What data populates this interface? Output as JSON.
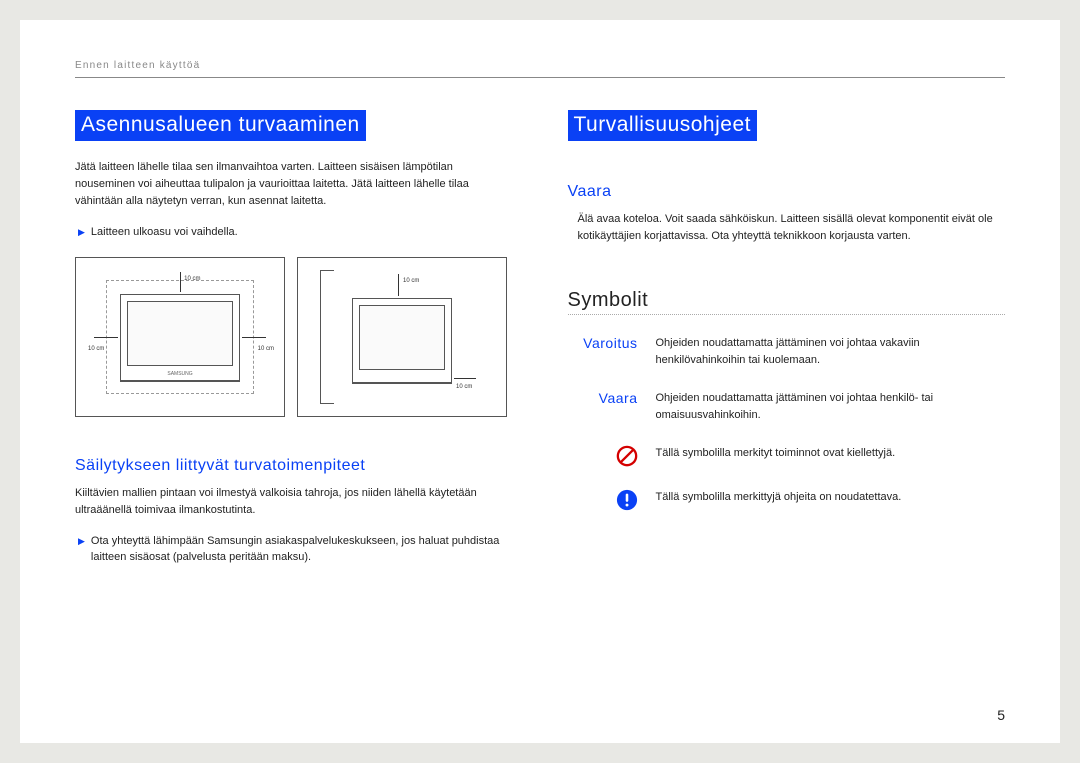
{
  "header": "Ennen laitteen käyttöä",
  "page_number": "5",
  "left": {
    "heading": "Asennusalueen turvaaminen",
    "body": "Jätä laitteen lähelle tilaa sen ilmanvaihtoa varten. Laitteen sisäisen lämpötilan nouseminen voi aiheuttaa tulipalon ja vaurioittaa laitetta. Jätä laitteen lähelle tilaa vähintään alla näytetyn verran, kun asennat laitetta.",
    "note": "Laitteen ulkoasu voi vaihdella.",
    "dim_top": "10 cm",
    "dim_left": "10 cm",
    "dim_right": "10 cm",
    "dim_bottom": "10 cm",
    "subheading": "Säilytykseen liittyvät turvatoimenpiteet",
    "storage_body": "Kiiltävien mallien pintaan voi ilmestyä valkoisia tahroja, jos niiden lähellä käytetään ultraäänellä toimivaa ilmankostutinta.",
    "storage_note": "Ota yhteyttä lähimpään Samsungin asiakaspalvelukeskukseen, jos haluat puhdistaa laitteen sisäosat (palvelusta peritään maksu)."
  },
  "right": {
    "heading": "Turvallisuusohjeet",
    "vaara_title": "Vaara",
    "vaara_body": "Älä avaa koteloa. Voit saada sähköiskun. Laitteen sisällä olevat komponentit eivät ole kotikäyttäjien korjattavissa. Ota yhteyttä teknikkoon korjausta varten.",
    "symbolit": "Symbolit",
    "defs": [
      {
        "term": "Varoitus",
        "desc": "Ohjeiden noudattamatta jättäminen voi johtaa vakaviin henkilövahinkoihin tai kuolemaan."
      },
      {
        "term": "Vaara",
        "desc": "Ohjeiden noudattamatta jättäminen voi johtaa henkilö- tai omaisuusvahinkoihin."
      }
    ],
    "sym_prohibit": "Tällä symbolilla merkityt toiminnot ovat kiellettyjä.",
    "sym_mandatory": "Tällä symbolilla merkittyjä ohjeita on noudatettava."
  }
}
